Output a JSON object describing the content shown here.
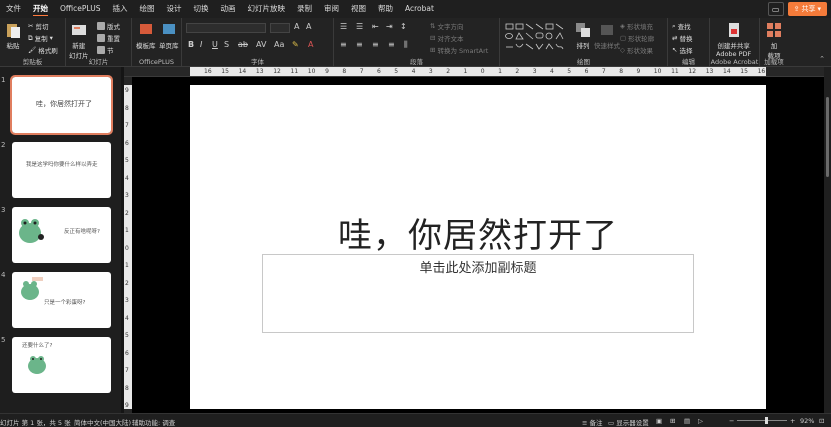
{
  "menu": {
    "items": [
      "文件",
      "开始",
      "插入",
      "绘图",
      "设计",
      "切换",
      "动画",
      "幻灯片放映",
      "录制",
      "审阅",
      "视图",
      "帮助",
      "Acrobat"
    ],
    "officeplus": "OfficePLUS",
    "active": "开始",
    "share_label": "共享"
  },
  "ribbon": {
    "clipboard": {
      "paste": "粘贴",
      "cut": "剪切",
      "copy": "复制",
      "format_painter": "格式刷",
      "label": "剪贴板"
    },
    "slides": {
      "new_slide": "新建",
      "new_slide2": "幻灯片",
      "layout": "版式",
      "reset": "重置",
      "section": "节",
      "label": "幻灯片"
    },
    "officeplus": {
      "templates": "模板库",
      "single_pages": "单页库",
      "label": "OfficePLUS"
    },
    "font": {
      "label": "字体",
      "bold": "B",
      "italic": "I",
      "underline": "U",
      "strike": "S"
    },
    "paragraph": {
      "text_direction": "文字方向",
      "align_text": "对齐文本",
      "smartart": "转换为 SmartArt",
      "label": "段落"
    },
    "drawing": {
      "arrange": "排列",
      "quick_styles": "快速样式",
      "fill": "形状填充",
      "outline": "形状轮廓",
      "effects": "形状效果",
      "label": "绘图"
    },
    "editing": {
      "find": "查找",
      "replace": "替换",
      "select": "选择",
      "label": "编辑"
    },
    "acrobat": {
      "create": "创建并共享",
      "create2": "Adobe PDF",
      "label": "Adobe Acrobat"
    },
    "addins": {
      "add": "加",
      "add2": "载项",
      "label": "加载项"
    }
  },
  "thumbnails": [
    {
      "num": "1",
      "text": "哇，你居然打开了"
    },
    {
      "num": "2",
      "text": "我是这学吗你要什么样以弄走"
    },
    {
      "num": "3",
      "text": "反正有啥呢呀?"
    },
    {
      "num": "4",
      "text": "只是一个彩蛋呀?"
    },
    {
      "num": "5",
      "text": "还要什么了?"
    }
  ],
  "ruler": {
    "h_labels": [
      "16",
      "15",
      "14",
      "13",
      "12",
      "11",
      "10",
      "9",
      "8",
      "7",
      "6",
      "5",
      "4",
      "3",
      "2",
      "1",
      "0",
      "1",
      "2",
      "3",
      "4",
      "5",
      "6",
      "7",
      "8",
      "9",
      "10",
      "11",
      "12",
      "13",
      "14",
      "15",
      "16"
    ],
    "v_labels": [
      "9",
      "8",
      "7",
      "6",
      "5",
      "4",
      "3",
      "2",
      "1",
      "0",
      "1",
      "2",
      "3",
      "4",
      "5",
      "6",
      "7",
      "8",
      "9"
    ]
  },
  "slide": {
    "title": "哇，你居然打开了",
    "subtitle_placeholder": "单击此处添加副标题"
  },
  "status": {
    "slide_count": "幻灯片 第 1 张，共 5 张",
    "language": "简体中文(中国大陆)",
    "accessibility": "辅助功能: 调查",
    "notes": "备注",
    "display_settings": "显示器设置",
    "zoom": "92%"
  },
  "colors": {
    "accent": "#f47b3a",
    "selection": "#e07e5f"
  }
}
